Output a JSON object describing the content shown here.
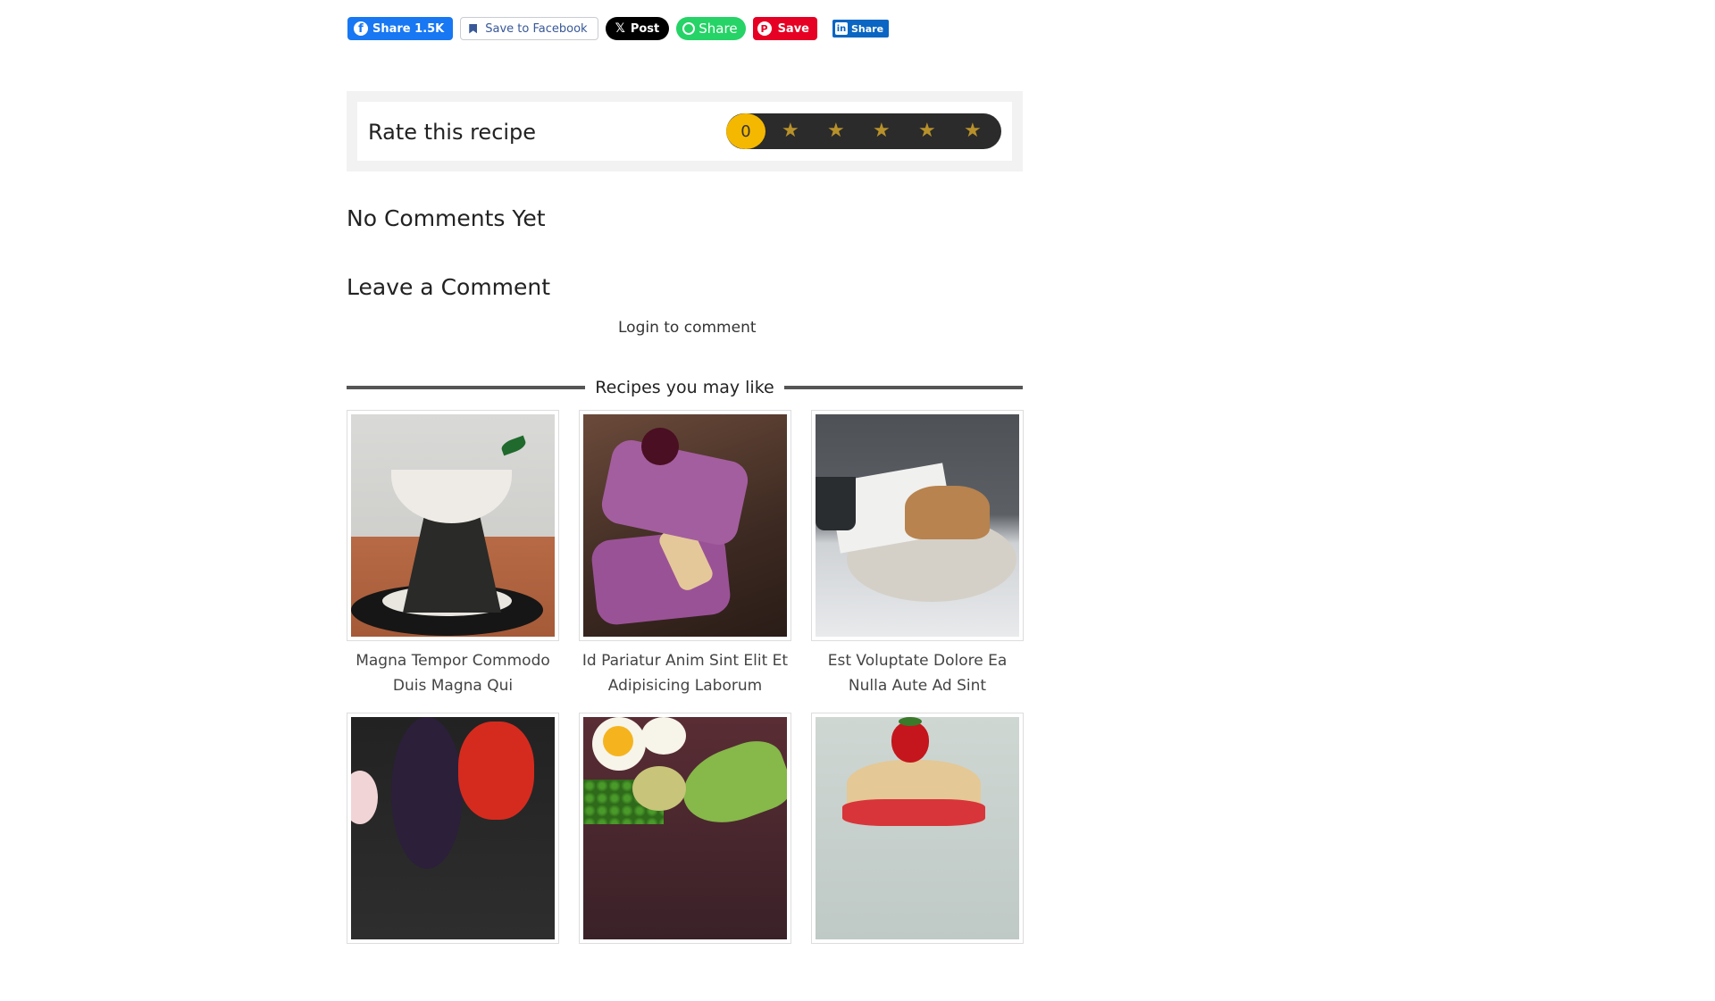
{
  "share_bar": {
    "facebook_share": {
      "icon": "facebook-icon",
      "label": "Share 1.5K"
    },
    "facebook_save": {
      "icon": "bookmark-icon",
      "label": "Save to Facebook"
    },
    "x_post": {
      "icon": "x-logo-icon",
      "label": "Post"
    },
    "whatsapp_share": {
      "icon": "whatsapp-icon",
      "label": "Share"
    },
    "pinterest_save": {
      "icon": "pinterest-icon",
      "label": "Save"
    },
    "linkedin_share": {
      "icon": "linkedin-icon",
      "label": "Share"
    }
  },
  "rating": {
    "label": "Rate this recipe",
    "count": "0",
    "max_stars": 5,
    "star_icon": "star-icon",
    "star_color": "#b8912a",
    "badge_color": "#f5b800"
  },
  "comments": {
    "heading": "No Comments Yet",
    "leave_heading": "Leave a Comment",
    "login_link": "Login to comment"
  },
  "recipes": {
    "section_title": "Recipes you may like",
    "items": [
      {
        "title": "Magna Tempor Commodo Duis Magna Qui"
      },
      {
        "title": "Id Pariatur Anim Sint Elit Et Adipisicing Laborum"
      },
      {
        "title": "Est Voluptate Dolore Ea Nulla Aute Ad Sint"
      },
      {
        "title": ""
      },
      {
        "title": ""
      },
      {
        "title": ""
      }
    ]
  },
  "colors": {
    "facebook": "#1877f2",
    "x": "#000000",
    "whatsapp": "#25d366",
    "pinterest": "#e60023",
    "linkedin": "#0a66c2"
  }
}
